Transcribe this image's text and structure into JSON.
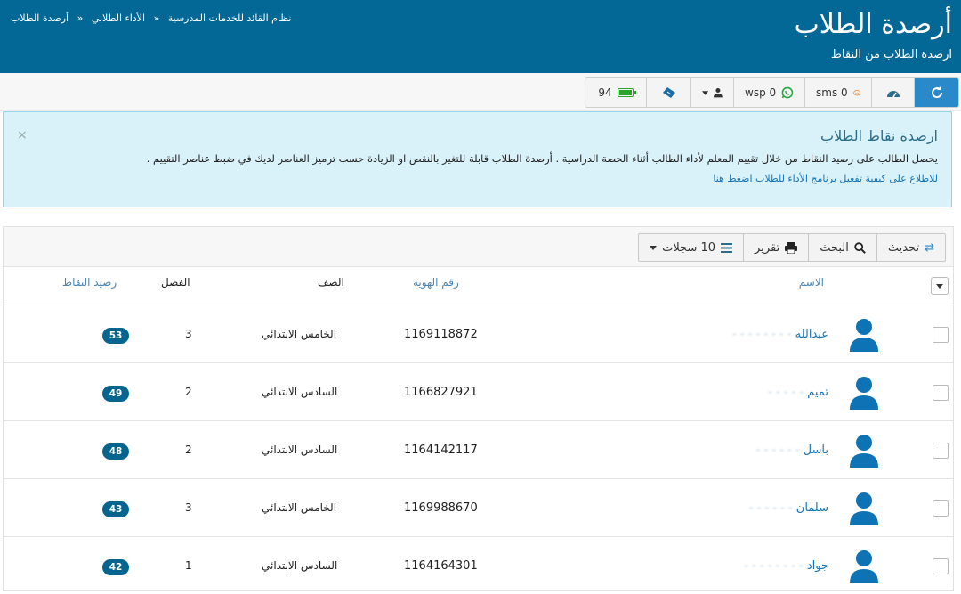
{
  "header": {
    "title": "أرصدة الطلاب",
    "subtitle": "ارصدة الطلاب من النقاط",
    "breadcrumb": [
      "نظام القائد للخدمات المدرسية",
      "الأداء الطلابي",
      "أرصدة الطلاب"
    ],
    "breadcrumb_sep": "«"
  },
  "toolbar": {
    "sms_label": "sms 0",
    "wsp_label": "wsp 0",
    "battery_value": "94"
  },
  "alert": {
    "title": "ارصدة نقاط الطلاب",
    "line1": "يحصل الطالب على رصيد النقاط من خلال تقييم المعلم لأداء الطالب أثناء الحصة الدراسية . أرصدة الطلاب قابلة للتغير بالنقص او الزيادة حسب ترميز العناصر لديك في ضبط عناصر التقييم .",
    "link": "للاطلاع على كيفية تفعيل برنامج الأداء للطلاب اضغط هنا",
    "close": "×"
  },
  "table_toolbar": {
    "refresh": "تحديث",
    "search": "البحث",
    "report": "تقرير",
    "records": "10 سجلات"
  },
  "columns": {
    "name": "الاسم",
    "id": "رقم الهوية",
    "grade": "الصف",
    "section": "الفصل",
    "points": "رصيد النقاط"
  },
  "rows": [
    {
      "name": "عبدالله",
      "id": "1169118872",
      "grade": "الخامس الابتدائي",
      "section": "3",
      "points": "53"
    },
    {
      "name": "تميم",
      "id": "1166827921",
      "grade": "السادس الابتدائي",
      "section": "2",
      "points": "49"
    },
    {
      "name": "باسل",
      "id": "1164142117",
      "grade": "السادس الابتدائي",
      "section": "2",
      "points": "48"
    },
    {
      "name": "سلمان",
      "id": "1169988670",
      "grade": "الخامس الابتدائي",
      "section": "3",
      "points": "43"
    },
    {
      "name": "جواد",
      "id": "1164164301",
      "grade": "السادس الابتدائي",
      "section": "1",
      "points": "42"
    }
  ],
  "colors": {
    "header_bg": "#046897",
    "accent": "#2a8ac9",
    "badge": "#05658f",
    "alert_bg": "#d9f1f8",
    "avatar": "#0d73b4"
  },
  "icons": [
    "refresh-icon",
    "dashboard-icon",
    "chat-icon",
    "whatsapp-icon",
    "user-icon",
    "ticket-icon",
    "battery-icon",
    "search-icon",
    "print-icon",
    "list-icon",
    "caret-down-icon",
    "close-icon"
  ]
}
